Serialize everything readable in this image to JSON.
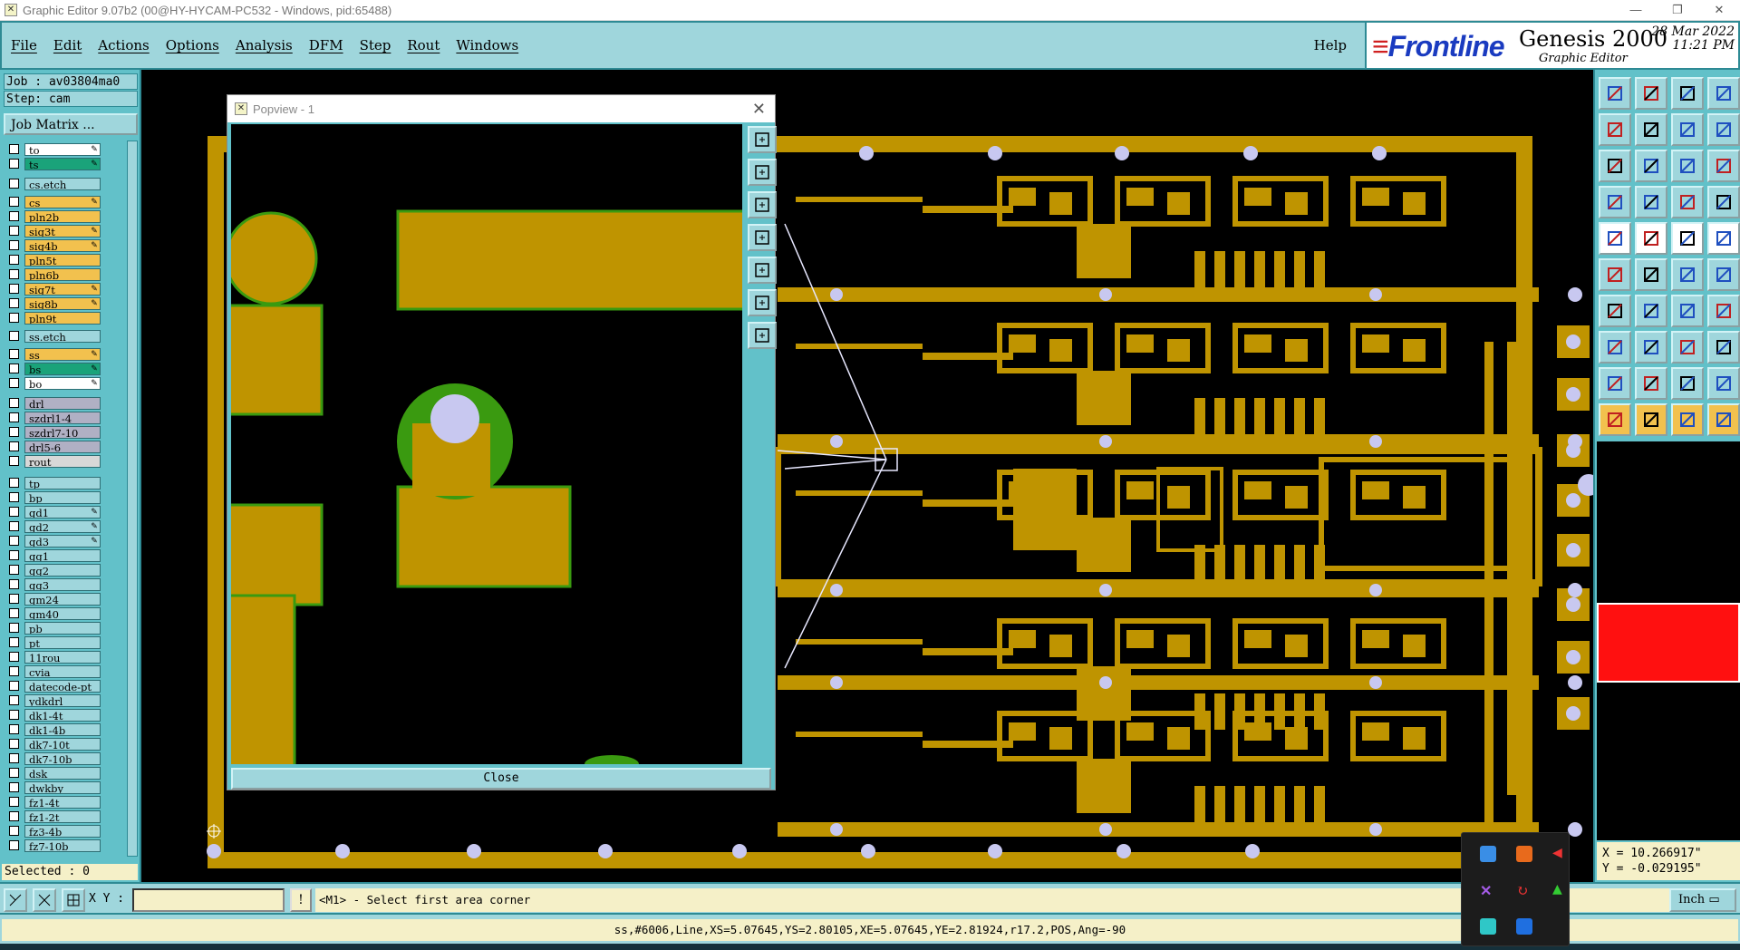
{
  "window": {
    "title": "Graphic Editor 9.07b2 (00@HY-HYCAM-PC532 - Windows, pid:65488)",
    "icon": "app-x-icon",
    "controls": [
      "minimize-icon",
      "restore-icon",
      "close-icon"
    ]
  },
  "menu": {
    "items": [
      "File",
      "Edit",
      "Actions",
      "Options",
      "Analysis",
      "DFM",
      "Step",
      "Rout",
      "Windows"
    ],
    "help": "Help"
  },
  "brand": {
    "logo": "Frontline",
    "product": "Genesis 2000",
    "subtitle": "Graphic Editor",
    "date": "28 Mar 2022",
    "time": "11:21 PM"
  },
  "job": {
    "job_line": "Job : av03804ma0",
    "step_line": "Step: cam",
    "matrix_button": "Job Matrix ..."
  },
  "layers": [
    {
      "name": "to",
      "color": "#ffffff",
      "pen": true
    },
    {
      "name": "ts",
      "color": "#1aa37a",
      "pen": true
    },
    {
      "name": "cs.etch",
      "color": "#9fd6dc",
      "pen": false
    },
    {
      "name": "cs",
      "color": "#f2c14e",
      "pen": true
    },
    {
      "name": "pln2b",
      "color": "#f2c14e",
      "pen": false
    },
    {
      "name": "sig3t",
      "color": "#f2c14e",
      "pen": true
    },
    {
      "name": "sig4b",
      "color": "#f2c14e",
      "pen": true
    },
    {
      "name": "pln5t",
      "color": "#f2c14e",
      "pen": false
    },
    {
      "name": "pln6b",
      "color": "#f2c14e",
      "pen": false
    },
    {
      "name": "sig7t",
      "color": "#f2c14e",
      "pen": true
    },
    {
      "name": "sig8b",
      "color": "#f2c14e",
      "pen": true
    },
    {
      "name": "pln9t",
      "color": "#f2c14e",
      "pen": false
    },
    {
      "name": "ss.etch",
      "color": "#9fd6dc",
      "pen": false
    },
    {
      "name": "ss",
      "color": "#f2c14e",
      "pen": true
    },
    {
      "name": "bs",
      "color": "#1aa37a",
      "pen": true
    },
    {
      "name": "bo",
      "color": "#ffffff",
      "pen": true
    },
    {
      "name": "drl",
      "color": "#b0b0c4",
      "pen": false
    },
    {
      "name": "szdrl1-4",
      "color": "#b0b0c4",
      "pen": false
    },
    {
      "name": "szdrl7-10",
      "color": "#b0b0c4",
      "pen": false
    },
    {
      "name": "drl5-6",
      "color": "#b0b0c4",
      "pen": false
    },
    {
      "name": "rout",
      "color": "#d8d8d8",
      "pen": false
    },
    {
      "name": "tp",
      "color": "#9fd6dc",
      "pen": false
    },
    {
      "name": "bp",
      "color": "#9fd6dc",
      "pen": false
    },
    {
      "name": "gd1",
      "color": "#9fd6dc",
      "pen": true
    },
    {
      "name": "gd2",
      "color": "#9fd6dc",
      "pen": true
    },
    {
      "name": "gd3",
      "color": "#9fd6dc",
      "pen": true
    },
    {
      "name": "gg1",
      "color": "#9fd6dc",
      "pen": false
    },
    {
      "name": "gg2",
      "color": "#9fd6dc",
      "pen": false
    },
    {
      "name": "gg3",
      "color": "#9fd6dc",
      "pen": false
    },
    {
      "name": "gm24",
      "color": "#9fd6dc",
      "pen": false
    },
    {
      "name": "gm40",
      "color": "#9fd6dc",
      "pen": false
    },
    {
      "name": "pb",
      "color": "#9fd6dc",
      "pen": false
    },
    {
      "name": "pt",
      "color": "#9fd6dc",
      "pen": false
    },
    {
      "name": "11rou",
      "color": "#9fd6dc",
      "pen": false
    },
    {
      "name": "cvia",
      "color": "#9fd6dc",
      "pen": false
    },
    {
      "name": "datecode-pt",
      "color": "#9fd6dc",
      "pen": false
    },
    {
      "name": "ydkdrl",
      "color": "#9fd6dc",
      "pen": false
    },
    {
      "name": "dk1-4t",
      "color": "#9fd6dc",
      "pen": false
    },
    {
      "name": "dk1-4b",
      "color": "#9fd6dc",
      "pen": false
    },
    {
      "name": "dk7-10t",
      "color": "#9fd6dc",
      "pen": false
    },
    {
      "name": "dk7-10b",
      "color": "#9fd6dc",
      "pen": false
    },
    {
      "name": "dsk",
      "color": "#9fd6dc",
      "pen": false
    },
    {
      "name": "dwkby",
      "color": "#9fd6dc",
      "pen": false
    },
    {
      "name": "fz1-4t",
      "color": "#9fd6dc",
      "pen": false
    },
    {
      "name": "fz1-2t",
      "color": "#9fd6dc",
      "pen": false
    },
    {
      "name": "fz3-4b",
      "color": "#9fd6dc",
      "pen": false
    },
    {
      "name": "fz7-10b",
      "color": "#9fd6dc",
      "pen": false
    }
  ],
  "selected_text": "Selected : 0",
  "popview": {
    "title": "Popview - 1",
    "close_label": "Close",
    "tools": [
      "zoom-home-icon",
      "pan-up-icon",
      "pan-down-icon",
      "pan-left-icon",
      "pan-right-icon",
      "zoom-fit-icon",
      "zoom-area-icon"
    ]
  },
  "command_bar": {
    "xy_label": "X Y :",
    "xy_value": "",
    "prompt": "<M1> - Select first area corner",
    "unit": "Inch",
    "prompt_button": "!"
  },
  "status": {
    "text": "ss,#6006,Line,XS=5.07645,YS=2.80105,XE=5.07645,YE=2.81924,r17.2,POS,Ang=-90"
  },
  "coords": {
    "x": "X = 10.266917\"",
    "y": "Y = -0.029195\""
  },
  "colors": {
    "copper": "#bf9400",
    "soldermask_green": "#3a9a10",
    "highlight_red": "#ff1010",
    "drill": "#c8c8f0",
    "panel": "#62c1c9",
    "panel_light": "#9fd6dc"
  },
  "right_toolbar": {
    "icons": [
      "zoom-in-icon",
      "zoom-out-icon",
      "home-view-icon",
      "window-icon",
      "pan-left-icon",
      "pan-right-icon",
      "redraw-icon",
      "snap-icon",
      "fit-icon",
      "center-icon",
      "scale-1to2-icon",
      "help-query-icon",
      "measure-icon",
      "grid-icon",
      "layer-stack-icon",
      "layer-stack-red-icon",
      "pad-icon",
      "surface-icon",
      "line-icon",
      "circle-icon",
      "move-node-icon",
      "delete-icon",
      "connect-icon",
      "split-icon",
      "angle-line-icon",
      "slant-line-icon",
      "arc-icon",
      "jog-icon",
      "select-net-icon",
      "horizontal-line-icon",
      "bracket-icon",
      "copy-icon",
      "triangle-icon",
      "polygon-icon",
      "fill-icon",
      "edge-icon",
      "pointer-icon",
      "select-pointer-icon",
      "move-pointer-icon",
      "pointer-plus-icon"
    ]
  },
  "tray": {
    "icons": [
      "blue-app-icon",
      "orange-app-icon",
      "speaker-icon",
      "purple-x-icon",
      "red-refresh-icon",
      "green-chart-icon",
      "cyan-app-icon",
      "bluetooth-icon"
    ]
  }
}
